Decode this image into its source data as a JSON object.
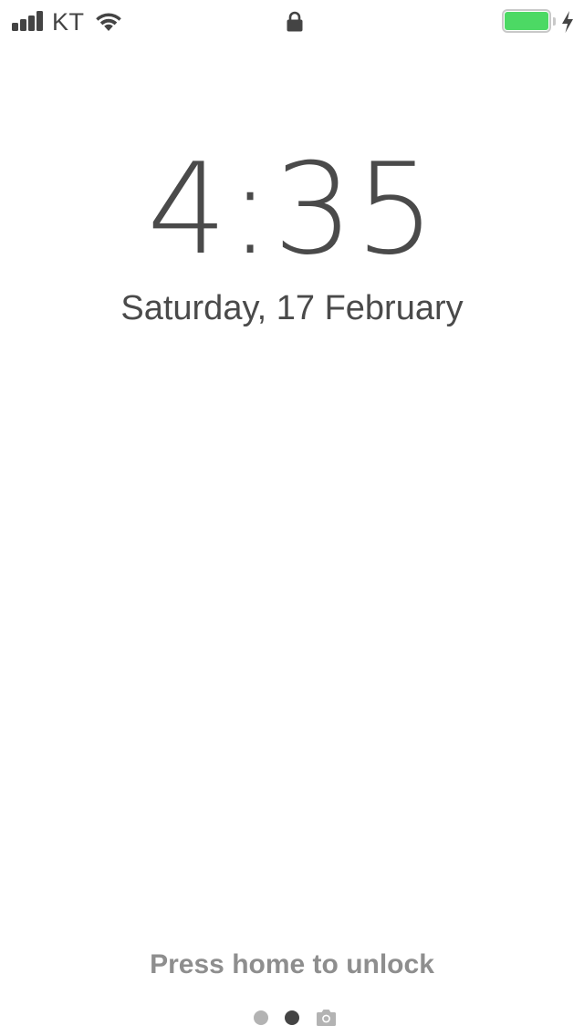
{
  "status_bar": {
    "carrier": "KT",
    "signal_bars": 4,
    "battery_level_percent": 100,
    "charging": true,
    "colors": {
      "icon": "#444444",
      "battery_fill": "#4cd964",
      "battery_outline": "#c9c9c9"
    }
  },
  "lock_screen": {
    "time": "4:35",
    "date": "Saturday, 17 February",
    "unlock_hint": "Press home to unlock",
    "page_indicator": {
      "pages": 2,
      "current_page": 2,
      "trailing_icon": "camera-icon",
      "active_color": "#444444",
      "inactive_color": "#b3b3b3"
    }
  }
}
